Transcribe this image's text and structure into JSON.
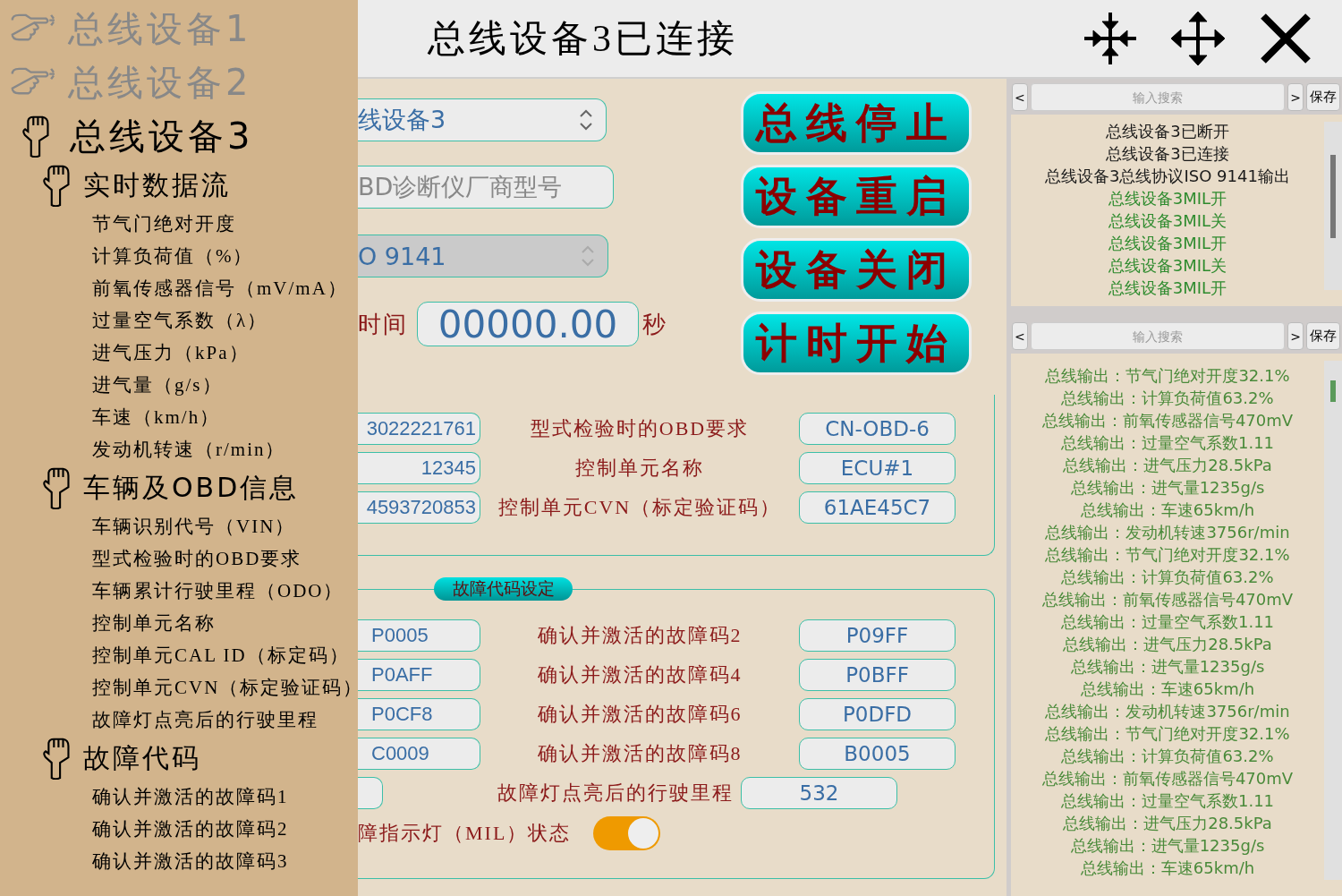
{
  "header": {
    "title": "总线设备3已连接"
  },
  "sidebar": {
    "items": [
      {
        "label": "总线设备1",
        "expanded": false
      },
      {
        "label": "总线设备2",
        "expanded": false
      },
      {
        "label": "总线设备3",
        "expanded": true,
        "children": [
          {
            "label": "实时数据流",
            "expanded": true,
            "children": [
              {
                "label": "节气门绝对开度"
              },
              {
                "label": "计算负荷值（%）"
              },
              {
                "label": "前氧传感器信号（mV/mA）"
              },
              {
                "label": "过量空气系数（λ）"
              },
              {
                "label": "进气压力（kPa）"
              },
              {
                "label": "进气量（g/s）"
              },
              {
                "label": "车速（km/h）"
              },
              {
                "label": "发动机转速（r/min）"
              }
            ]
          },
          {
            "label": "车辆及OBD信息",
            "expanded": true,
            "children": [
              {
                "label": "车辆识别代号（VIN）"
              },
              {
                "label": "型式检验时的OBD要求"
              },
              {
                "label": "车辆累计行驶里程（ODO）"
              },
              {
                "label": "控制单元名称"
              },
              {
                "label": "控制单元CAL ID（标定码）"
              },
              {
                "label": "控制单元CVN（标定验证码）"
              },
              {
                "label": "故障灯点亮后的行驶里程"
              }
            ]
          },
          {
            "label": "故障代码",
            "expanded": true,
            "children": [
              {
                "label": "确认并激活的故障码1"
              },
              {
                "label": "确认并激活的故障码2"
              },
              {
                "label": "确认并激活的故障码3"
              }
            ]
          }
        ]
      }
    ]
  },
  "connection": {
    "device_select": "线设备3",
    "model_field": "BD诊断仪厂商型号",
    "protocol_select": {
      "value": "O 9141",
      "disabled": true
    },
    "timer": {
      "label": "时间",
      "value": "00000.00",
      "unit": "秒"
    }
  },
  "buttons": [
    "总线停止",
    "设备重启",
    "设备关闭",
    "计时开始"
  ],
  "vehicle_info": {
    "rows": [
      {
        "left_value": "3022221761",
        "label": "型式检验时的OBD要求",
        "value": "CN-OBD-6"
      },
      {
        "left_value": "12345",
        "label": "控制单元名称",
        "value": "ECU#1"
      },
      {
        "left_value": "4593720853",
        "label": "控制单元CVN（标定验证码）",
        "value": "61AE45C7"
      }
    ]
  },
  "fault_codes": {
    "title": "故障代码设定",
    "rows": [
      {
        "left_value": "P0005",
        "label": "确认并激活的故障码2",
        "value": "P09FF"
      },
      {
        "left_value": "P0AFF",
        "label": "确认并激活的故障码4",
        "value": "P0BFF"
      },
      {
        "left_value": "P0CF8",
        "label": "确认并激活的故障码6",
        "value": "P0DFD"
      },
      {
        "left_value": "C0009",
        "label": "确认并激活的故障码8",
        "value": "B0005"
      }
    ],
    "mileage": {
      "label": "故障灯点亮后的行驶里程",
      "value": "532"
    },
    "mil": {
      "label": "障指示灯（MIL）状态",
      "on": true
    }
  },
  "logs": [
    {
      "prev": "<",
      "search_placeholder": "输入搜索",
      "next": ">",
      "save": "保存",
      "entries": [
        {
          "text": "总线设备3已断开",
          "color": "#1a1a1a"
        },
        {
          "text": "总线设备3已连接",
          "color": "#1a1a1a"
        },
        {
          "text": "总线设备3总线协议ISO 9141输出",
          "color": "#1a1a1a"
        },
        {
          "text": "总线设备3MIL开",
          "color": "#2e8b2e"
        },
        {
          "text": "总线设备3MIL关",
          "color": "#2e8b2e"
        },
        {
          "text": "总线设备3MIL开",
          "color": "#2e8b2e"
        },
        {
          "text": "总线设备3MIL关",
          "color": "#2e8b2e"
        },
        {
          "text": "总线设备3MIL开",
          "color": "#2e8b2e"
        }
      ]
    },
    {
      "prev": "<",
      "search_placeholder": "输入搜索",
      "next": ">",
      "save": "保存",
      "entries": [
        {
          "text": "总线输出：节气门绝对开度32.1%",
          "color": "#4a8a3a"
        },
        {
          "text": "总线输出：计算负荷值63.2%",
          "color": "#4a8a3a"
        },
        {
          "text": "总线输出：前氧传感器信号470mV",
          "color": "#4a8a3a"
        },
        {
          "text": "总线输出：过量空气系数1.11",
          "color": "#4a8a3a"
        },
        {
          "text": "总线输出：进气压力28.5kPa",
          "color": "#4a8a3a"
        },
        {
          "text": "总线输出：进气量1235g/s",
          "color": "#4a8a3a"
        },
        {
          "text": "总线输出：车速65km/h",
          "color": "#4a8a3a"
        },
        {
          "text": "总线输出：发动机转速3756r/min",
          "color": "#4a8a3a"
        },
        {
          "text": "总线输出：节气门绝对开度32.1%",
          "color": "#4a8a3a"
        },
        {
          "text": "总线输出：计算负荷值63.2%",
          "color": "#4a8a3a"
        },
        {
          "text": "总线输出：前氧传感器信号470mV",
          "color": "#4a8a3a"
        },
        {
          "text": "总线输出：过量空气系数1.11",
          "color": "#4a8a3a"
        },
        {
          "text": "总线输出：进气压力28.5kPa",
          "color": "#4a8a3a"
        },
        {
          "text": "总线输出：进气量1235g/s",
          "color": "#4a8a3a"
        },
        {
          "text": "总线输出：车速65km/h",
          "color": "#4a8a3a"
        },
        {
          "text": "总线输出：发动机转速3756r/min",
          "color": "#4a8a3a"
        },
        {
          "text": "总线输出：节气门绝对开度32.1%",
          "color": "#4a8a3a"
        },
        {
          "text": "总线输出：计算负荷值63.2%",
          "color": "#4a8a3a"
        },
        {
          "text": "总线输出：前氧传感器信号470mV",
          "color": "#4a8a3a"
        },
        {
          "text": "总线输出：过量空气系数1.11",
          "color": "#4a8a3a"
        },
        {
          "text": "总线输出：进气压力28.5kPa",
          "color": "#4a8a3a"
        },
        {
          "text": "总线输出：进气量1235g/s",
          "color": "#4a8a3a"
        },
        {
          "text": "总线输出：车速65km/h",
          "color": "#4a8a3a"
        }
      ]
    }
  ]
}
